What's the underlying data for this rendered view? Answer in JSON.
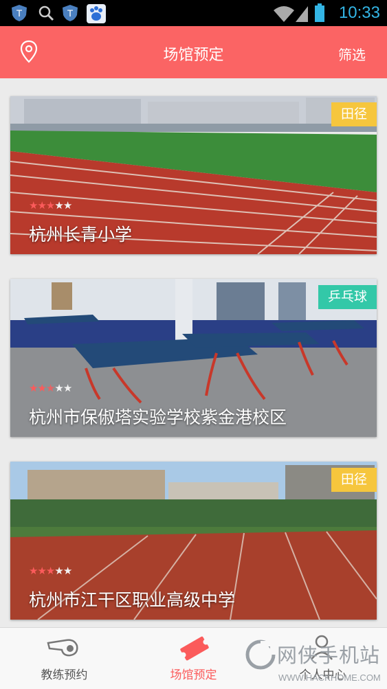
{
  "status_bar": {
    "time": "10:33"
  },
  "header": {
    "title": "场馆预定",
    "filter_label": "筛选",
    "location_icon": "location-pin-icon"
  },
  "venues": [
    {
      "name": "杭州长青小学",
      "tag": "田径",
      "rating": 3,
      "max_rating": 5
    },
    {
      "name": "杭州市保俶塔实验学校紫金港校区",
      "tag": "乒乓球",
      "rating": 2.5,
      "max_rating": 5
    },
    {
      "name": "杭州市江干区职业高级中学",
      "tag": "田径",
      "rating": 3,
      "max_rating": 5
    }
  ],
  "tabs": [
    {
      "label": "教练预约",
      "icon": "whistle-icon",
      "active": false
    },
    {
      "label": "场馆预定",
      "icon": "ticket-icon",
      "active": true
    },
    {
      "label": "个人中心",
      "icon": "person-icon",
      "active": false
    }
  ],
  "watermark": {
    "text": "网侠手机站",
    "url": "WWW.HACKHOME.COM"
  },
  "colors": {
    "brand": "#fb6464",
    "track_tag": "#f6c63d",
    "pingpong_tag": "#33c8a8",
    "star_on": "#fb5b5b"
  }
}
